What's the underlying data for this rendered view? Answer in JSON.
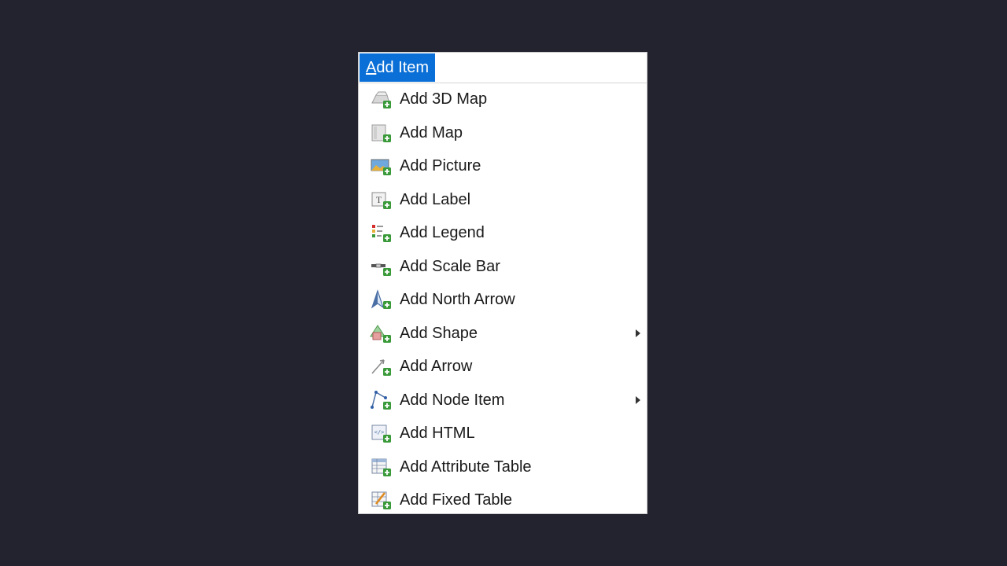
{
  "menu": {
    "title_mnemonic": "A",
    "title_rest": "dd Item",
    "items": [
      {
        "label": "Add 3D Map",
        "icon": "3d-map-icon",
        "submenu": false
      },
      {
        "label": "Add Map",
        "icon": "map-icon",
        "submenu": false
      },
      {
        "label": "Add Picture",
        "icon": "picture-icon",
        "submenu": false
      },
      {
        "label": "Add Label",
        "icon": "label-icon",
        "submenu": false
      },
      {
        "label": "Add Legend",
        "icon": "legend-icon",
        "submenu": false
      },
      {
        "label": "Add Scale Bar",
        "icon": "scale-bar-icon",
        "submenu": false
      },
      {
        "label": "Add North Arrow",
        "icon": "north-arrow-icon",
        "submenu": false
      },
      {
        "label": "Add Shape",
        "icon": "shape-icon",
        "submenu": true
      },
      {
        "label": "Add Arrow",
        "icon": "arrow-icon",
        "submenu": false
      },
      {
        "label": "Add Node Item",
        "icon": "node-item-icon",
        "submenu": true
      },
      {
        "label": "Add HTML",
        "icon": "html-icon",
        "submenu": false
      },
      {
        "label": "Add Attribute Table",
        "icon": "attribute-table-icon",
        "submenu": false
      },
      {
        "label": "Add Fixed Table",
        "icon": "fixed-table-icon",
        "submenu": false
      }
    ]
  },
  "colors": {
    "background": "#22232e",
    "highlight": "#0a6fd6",
    "add_badge": "#3a9a3a"
  }
}
